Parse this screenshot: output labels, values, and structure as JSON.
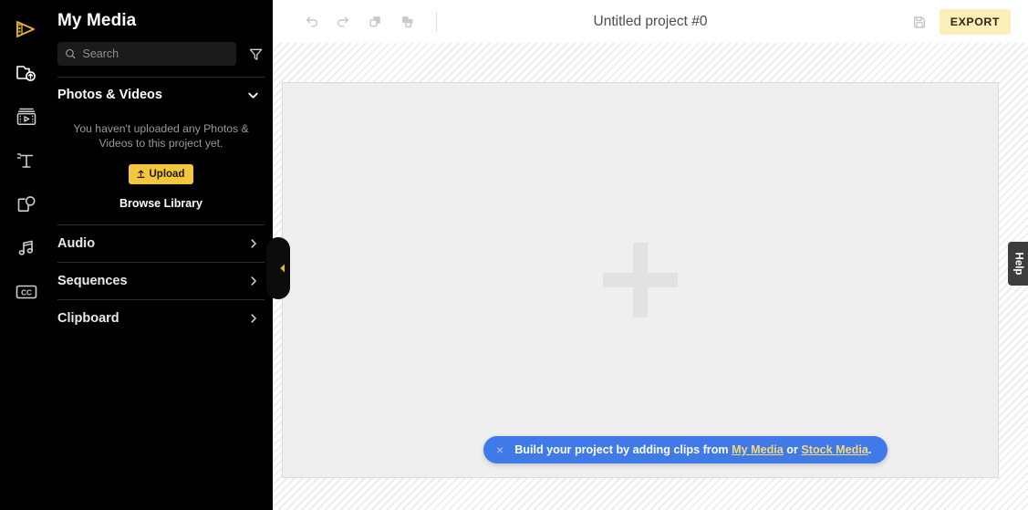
{
  "rail": {
    "items": [
      {
        "name": "logo-filmstrip-icon",
        "label": "Logo"
      },
      {
        "name": "my-media-icon",
        "label": "My Media"
      },
      {
        "name": "stock-media-icon",
        "label": "Stock Media"
      },
      {
        "name": "text-icon",
        "label": "Text"
      },
      {
        "name": "overlays-icon",
        "label": "Overlays"
      },
      {
        "name": "audio-icon",
        "label": "Audio"
      },
      {
        "name": "captions-icon",
        "label": "Captions"
      }
    ]
  },
  "sidebar": {
    "title": "My Media",
    "search": {
      "value": "",
      "placeholder": "Search"
    },
    "filter_label": "Filter",
    "photos_section": {
      "label": "Photos & Videos",
      "empty_message": "You haven't uploaded any Photos & Videos to this project yet.",
      "upload_label": "Upload",
      "browse_label": "Browse Library"
    },
    "accordions": [
      {
        "label": "Audio"
      },
      {
        "label": "Sequences"
      },
      {
        "label": "Clipboard"
      }
    ],
    "collapse_label": "Collapse panel"
  },
  "topbar": {
    "undo_label": "Undo",
    "redo_label": "Redo",
    "duplicate_label": "Duplicate",
    "split_label": "Split",
    "project_title": "Untitled project #0",
    "save_label": "Save",
    "export_label": "EXPORT"
  },
  "stage": {
    "add_media_label": "Add media"
  },
  "toast": {
    "close_label": "×",
    "text_before": "Build your project by adding clips from ",
    "link1": "My Media",
    "text_middle": " or ",
    "link2": "Stock Media",
    "text_after": "."
  },
  "help": {
    "label": "Help"
  },
  "colors": {
    "sidebar_bg": "#000000",
    "accent_gold": "#f2c73d",
    "export_bg": "#fbeeb8",
    "toast_bg": "#3f7ae8",
    "toast_link": "#f5d87a",
    "canvas_bg": "#efefef",
    "help_bg": "#3d3d3d"
  }
}
